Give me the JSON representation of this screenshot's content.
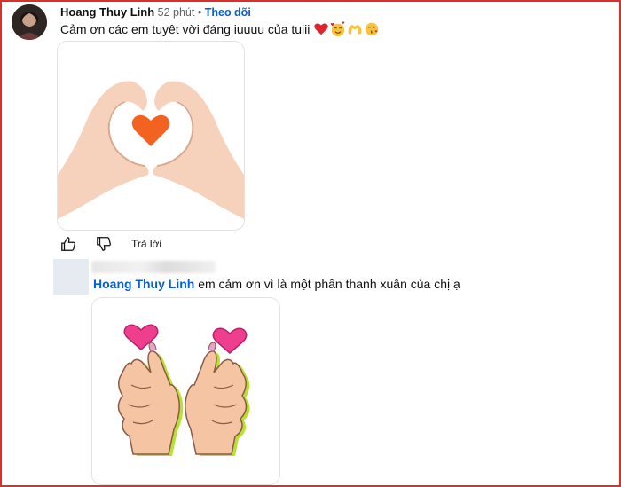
{
  "comment": {
    "author": "Hoang Thuy Linh",
    "time": "52 phút",
    "separator": "•",
    "follow_label": "Theo dõi",
    "text": "Cảm ơn các em tuyệt vời đáng iuuuu của tuiii",
    "emoji_icons": [
      "red-heart-icon",
      "smiling-face-with-hearts-icon",
      "heart-hands-icon",
      "face-blowing-kiss-icon"
    ],
    "reply_label": "Trả lời"
  },
  "reply": {
    "mention": "Hoang Thuy Linh",
    "text": "em cảm ơn vì là một phần thanh xuân của chị ạ"
  },
  "colors": {
    "frame": "#d9302c",
    "link": "#065fd4",
    "heart_orange": "#f26322",
    "heart_pink": "#ee3f8f",
    "skin": "#f5c4a3"
  }
}
